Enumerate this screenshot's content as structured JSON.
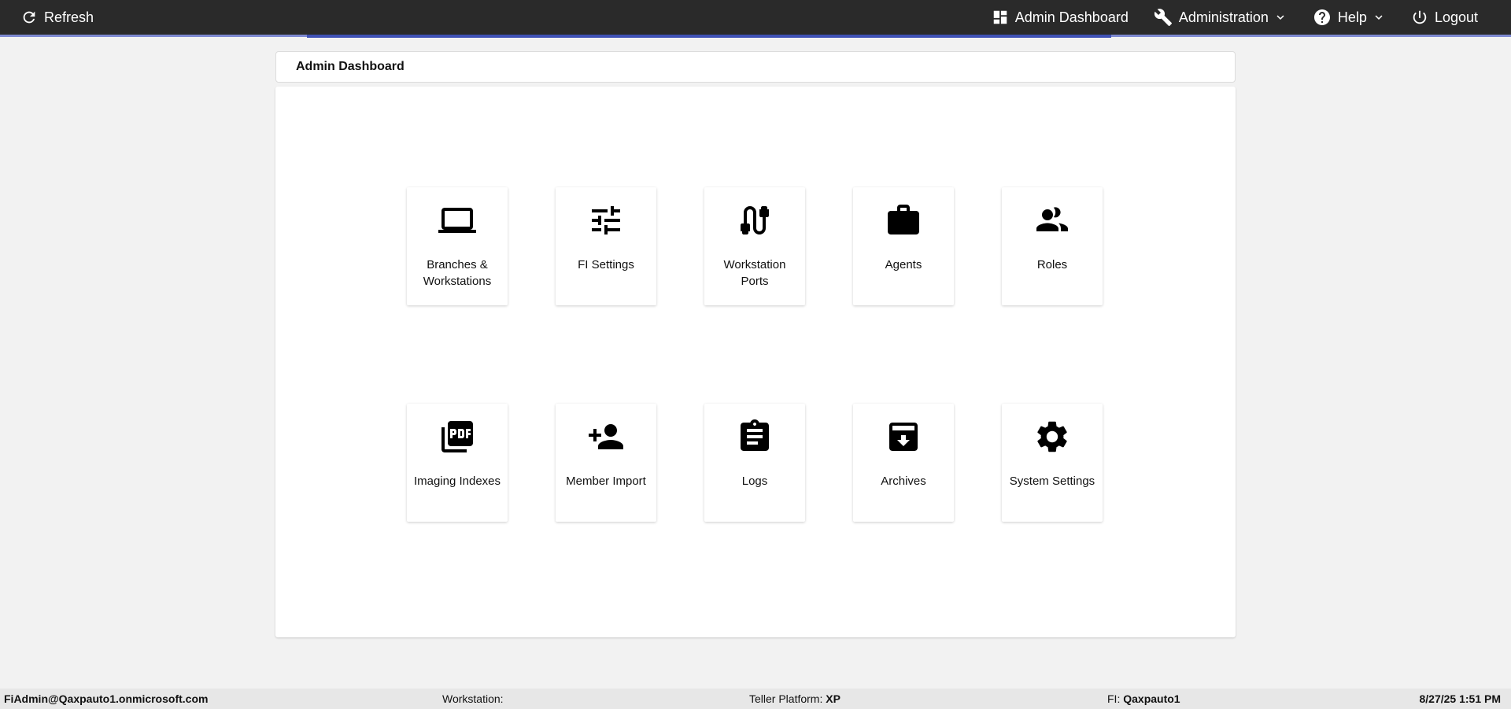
{
  "topbar": {
    "refresh_label": "Refresh",
    "admin_dashboard_label": "Admin Dashboard",
    "administration_label": "Administration",
    "help_label": "Help",
    "logout_label": "Logout"
  },
  "page": {
    "title": "Admin Dashboard"
  },
  "tiles": [
    {
      "label": "Branches & Workstations",
      "icon": "laptop-icon"
    },
    {
      "label": "FI Settings",
      "icon": "tune-sliders-icon"
    },
    {
      "label": "Workstation Ports",
      "icon": "cable-ports-icon"
    },
    {
      "label": "Agents",
      "icon": "briefcase-icon"
    },
    {
      "label": "Roles",
      "icon": "people-icon"
    },
    {
      "label": "Imaging Indexes",
      "icon": "pdf-icon"
    },
    {
      "label": "Member Import",
      "icon": "person-add-icon"
    },
    {
      "label": "Logs",
      "icon": "clipboard-icon"
    },
    {
      "label": "Archives",
      "icon": "archive-icon"
    },
    {
      "label": "System Settings",
      "icon": "gear-icon"
    }
  ],
  "statusbar": {
    "user": "FiAdmin@Qaxpauto1.onmicrosoft.com",
    "workstation_label": "Workstation:",
    "workstation_value": "",
    "teller_platform_label": "Teller Platform:",
    "teller_platform_value": "XP",
    "fi_label": "FI:",
    "fi_value": "Qaxpauto1",
    "datetime": "8/27/25 1:51 PM"
  },
  "colors": {
    "topbar_bg": "#2a2a2a",
    "accent": "#3f51b5",
    "page_bg": "#f2f2f2"
  }
}
